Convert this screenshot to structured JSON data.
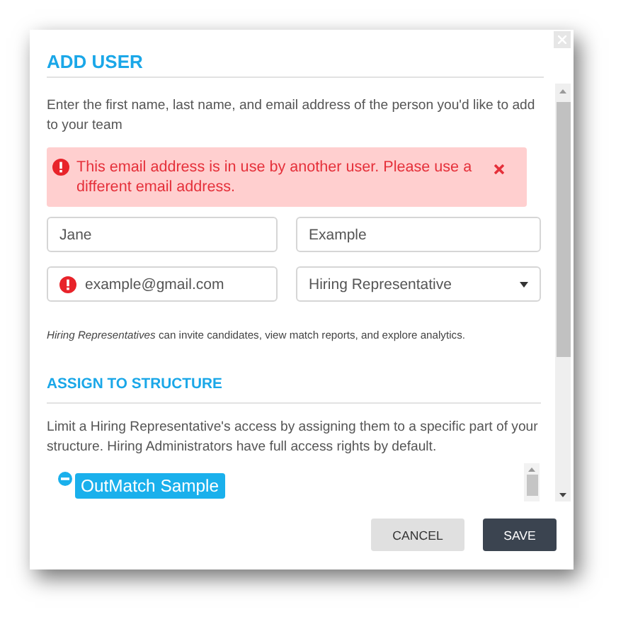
{
  "dialog": {
    "title": "ADD USER",
    "intro": "Enter the first name, last name, and email address of the person you'd like to add to your team",
    "error": {
      "message": "This email address is in use by another user. Please use a different email address.",
      "visible": true
    },
    "fields": [
      {
        "kind": "text",
        "value": "Jane",
        "error": false
      },
      {
        "kind": "text",
        "value": "Example",
        "error": false
      },
      {
        "kind": "text",
        "value": "example@gmail.com",
        "error": true
      },
      {
        "kind": "select",
        "value": "Hiring Representative",
        "error": false
      }
    ],
    "role_hint": "*Hiring Representatives* can invite candidates, view match reports, and explore analytics.",
    "section": {
      "title": "ASSIGN TO STRUCTURE",
      "description": "Limit a Hiring Representative's access by assigning them to a specific part of your structure. Hiring Administrators have full access rights by default."
    },
    "tree": [
      {
        "label": "OutMatch Sample",
        "selected": true,
        "expanded": true
      }
    ],
    "buttons": [
      {
        "kind": "secondary",
        "label": "CANCEL"
      },
      {
        "kind": "primary",
        "label": "SAVE"
      }
    ]
  }
}
